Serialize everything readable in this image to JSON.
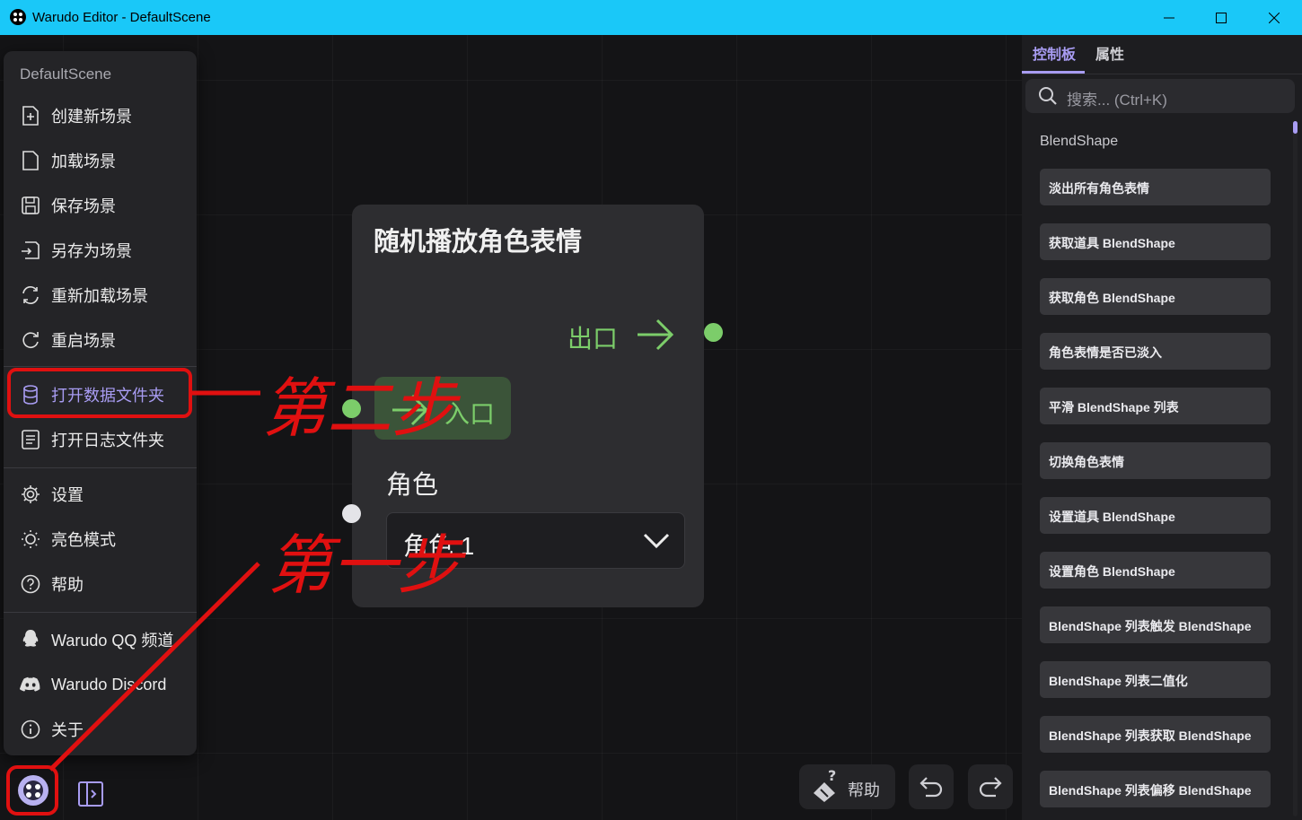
{
  "window": {
    "title": "Warudo Editor - DefaultScene"
  },
  "menu": {
    "scene_name": "DefaultScene",
    "items": [
      {
        "label": "创建新场景",
        "icon": "file-plus-icon"
      },
      {
        "label": "加载场景",
        "icon": "file-icon"
      },
      {
        "label": "保存场景",
        "icon": "save-icon"
      },
      {
        "label": "另存为场景",
        "icon": "save-as-icon"
      },
      {
        "label": "重新加载场景",
        "icon": "reload-icon"
      },
      {
        "label": "重启场景",
        "icon": "restart-icon"
      },
      {
        "label": "打开数据文件夹",
        "icon": "database-icon"
      },
      {
        "label": "打开日志文件夹",
        "icon": "log-file-icon"
      },
      {
        "label": "设置",
        "icon": "gear-icon"
      },
      {
        "label": "亮色模式",
        "icon": "sun-icon"
      },
      {
        "label": "帮助",
        "icon": "help-icon"
      },
      {
        "label": "Warudo QQ 频道",
        "icon": "qq-icon"
      },
      {
        "label": "Warudo Discord",
        "icon": "discord-icon"
      },
      {
        "label": "关于",
        "icon": "info-icon"
      }
    ]
  },
  "node": {
    "title": "随机播放角色表情",
    "exit_label": "出口",
    "entry_label": "入口",
    "character_label": "角色",
    "character_value": "角色 1"
  },
  "toolbar": {
    "help_label": "帮助"
  },
  "panel": {
    "tabs": [
      "控制板",
      "属性"
    ],
    "search_placeholder": "搜索... (Ctrl+K)",
    "section": "BlendShape",
    "items": [
      "淡出所有角色表情",
      "获取道具 BlendShape",
      "获取角色 BlendShape",
      "角色表情是否已淡入",
      "平滑 BlendShape 列表",
      "切换角色表情",
      "设置道具 BlendShape",
      "设置角色 BlendShape",
      "BlendShape 列表触发 BlendShape",
      "BlendShape 列表二值化",
      "BlendShape 列表获取 BlendShape",
      "BlendShape 列表偏移 BlendShape"
    ]
  },
  "annotations": [
    "第二步",
    "第一步"
  ],
  "colors": {
    "titlebar": "#1ac8f8",
    "accent": "#a89cf2",
    "flow_green": "#7ccd6a",
    "annotation_red": "#e01010"
  }
}
